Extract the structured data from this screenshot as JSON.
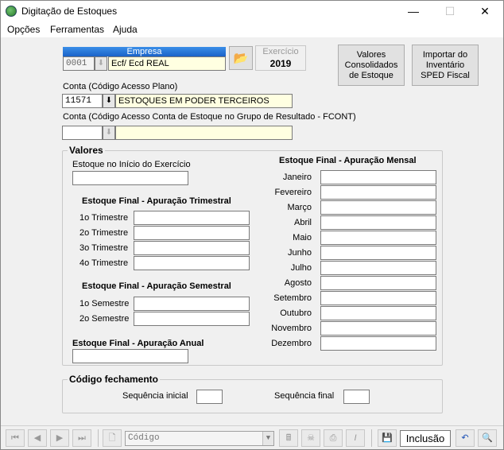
{
  "window": {
    "title": "Digitação de Estoques"
  },
  "menu": [
    {
      "label": "Opções"
    },
    {
      "label": "Ferramentas"
    },
    {
      "label": "Ajuda"
    }
  ],
  "empresa": {
    "header": "Empresa",
    "code": "0001",
    "name": "Ecf/ Ecd REAL"
  },
  "exercicio": {
    "label": "Exercício",
    "year": "2019"
  },
  "buttons": {
    "valores": "Valores Consolidados de Estoque",
    "importar": "Importar do Inventário SPED Fiscal"
  },
  "conta": {
    "label": "Conta (Código Acesso Plano)",
    "code": "11571",
    "description": "ESTOQUES EM PODER TERCEIROS"
  },
  "conta_fcont": {
    "label": "Conta (Código Acesso Conta de Estoque no Grupo de Resultado - FCONT)",
    "code": "",
    "description": ""
  },
  "valores": {
    "title": "Valores",
    "inicio_label": "Estoque no Início do Exercício",
    "trimestral_title": "Estoque Final - Apuração Trimestral",
    "trimestres": [
      "1o Trimestre",
      "2o Trimestre",
      "3o Trimestre",
      "4o Trimestre"
    ],
    "semestral_title": "Estoque Final - Apuração Semestral",
    "semestres": [
      "1o Semestre",
      "2o Semestre"
    ],
    "anual_title": "Estoque Final - Apuração Anual",
    "mensal_title": "Estoque Final - Apuração Mensal",
    "meses": [
      "Janeiro",
      "Fevereiro",
      "Março",
      "Abril",
      "Maio",
      "Junho",
      "Julho",
      "Agosto",
      "Setembro",
      "Outubro",
      "Novembro",
      "Dezembro"
    ]
  },
  "fechamento": {
    "title": "Código fechamento",
    "seq_inicial_label": "Sequência inicial",
    "seq_final_label": "Sequência final"
  },
  "toolbar": {
    "combo_value": "Código",
    "mode": "Inclusão"
  }
}
